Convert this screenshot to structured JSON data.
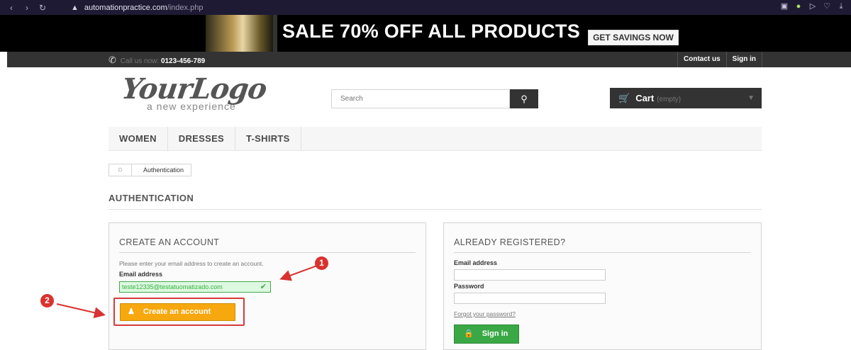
{
  "browser": {
    "url_host": "automationpractice.com",
    "url_path": "/index.php"
  },
  "banner": {
    "sale_text": "SALE 70% OFF ALL PRODUCTS",
    "cta_label": "GET SAVINGS NOW"
  },
  "topbar": {
    "call_label": "Call us now:",
    "phone_number": "0123-456-789",
    "contact_label": "Contact us",
    "signin_label": "Sign in"
  },
  "logo": {
    "script": "YourLogo",
    "tagline": "a new experience"
  },
  "search": {
    "placeholder": "Search"
  },
  "cart": {
    "label": "Cart",
    "state": "(empty)"
  },
  "menu": {
    "items": [
      "WOMEN",
      "DRESSES",
      "T-SHIRTS"
    ]
  },
  "breadcrumb": {
    "current": "Authentication"
  },
  "page": {
    "title": "AUTHENTICATION"
  },
  "create_account": {
    "heading": "CREATE AN ACCOUNT",
    "intro": "Please enter your email address to create an account.",
    "email_label": "Email address",
    "email_value": "teste12335@testatuomatizado.com",
    "button_label": "Create an account"
  },
  "registered": {
    "heading": "ALREADY REGISTERED?",
    "email_label": "Email address",
    "email_value": "",
    "password_label": "Password",
    "password_value": "",
    "forgot_label": "Forgot your password?",
    "button_label": "Sign in"
  },
  "annotations": {
    "badge_1": "1",
    "badge_2": "2"
  },
  "colors": {
    "accent_orange": "#f7a80f",
    "signin_green": "#3aa845",
    "annotation_red": "#d9322f"
  }
}
